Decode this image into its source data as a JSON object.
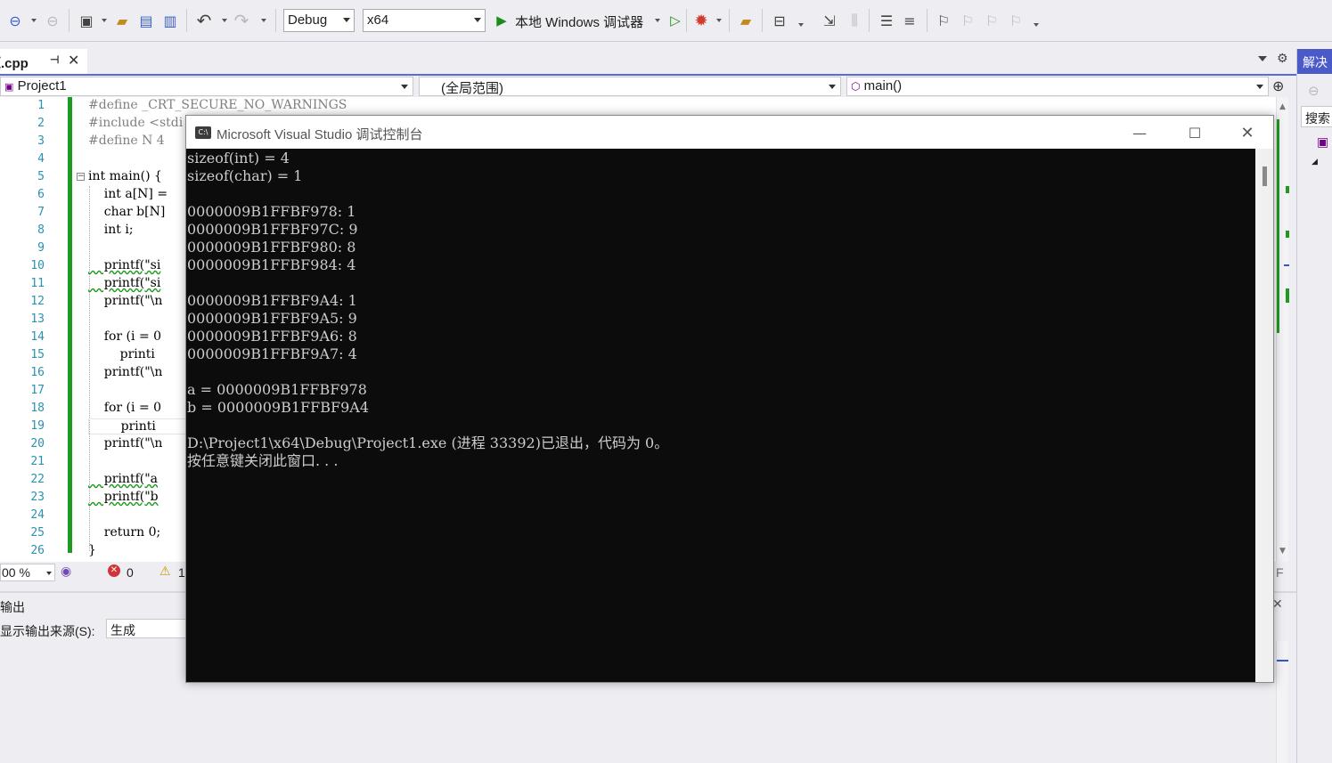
{
  "toolbar": {
    "config": "Debug",
    "platform": "x64",
    "run_label": "本地 Windows 调试器"
  },
  "tab": {
    "file_name": "源.cpp",
    "pin_icon": "pin-icon",
    "close_icon": "close-icon"
  },
  "navbar": {
    "project": "Project1",
    "scope": "(全局范围)",
    "member": "main()"
  },
  "editor": {
    "line_numbers": [
      "1",
      "2",
      "3",
      "4",
      "5",
      "6",
      "7",
      "8",
      "9",
      "10",
      "11",
      "12",
      "13",
      "14",
      "15",
      "16",
      "17",
      "18",
      "19",
      "20",
      "21",
      "22",
      "23",
      "24",
      "25",
      "26"
    ],
    "lines": [
      "#define _CRT_SECURE_NO_WARNINGS",
      "#include <stdi",
      "#define N 4",
      "",
      "int main() {",
      "    int a[N] =",
      "    char b[N]",
      "    int i;",
      "",
      "    printf(\"si",
      "    printf(\"si",
      "    printf(\"\\n",
      "",
      "    for (i = 0",
      "        printi",
      "    printf(\"\\n",
      "",
      "    for (i = 0",
      "        printi",
      "    printf(\"\\n",
      "",
      "    printf(\"a",
      "    printf(\"b",
      "",
      "    return 0;",
      "}"
    ]
  },
  "status": {
    "zoom": "00 %",
    "errors": "0",
    "warnings": "1",
    "right_letter": "F"
  },
  "output": {
    "title": "输出",
    "source_label": "显示输出来源(S):",
    "source_value": "生成"
  },
  "side_panel": {
    "title": "解决",
    "search": "搜索"
  },
  "console": {
    "title": "Microsoft Visual Studio 调试控制台",
    "icon_text": "C:\\",
    "lines": [
      "sizeof(int) = 4",
      "sizeof(char) = 1",
      "",
      "0000009B1FFBF978: 1",
      "0000009B1FFBF97C: 9",
      "0000009B1FFBF980: 8",
      "0000009B1FFBF984: 4",
      "",
      "0000009B1FFBF9A4: 1",
      "0000009B1FFBF9A5: 9",
      "0000009B1FFBF9A6: 8",
      "0000009B1FFBF9A7: 4",
      "",
      "a = 0000009B1FFBF978",
      "b = 0000009B1FFBF9A4",
      "",
      "D:\\Project1\\x64\\Debug\\Project1.exe (进程 33392)已退出，代码为 0。",
      "按任意键关闭此窗口. . ."
    ]
  }
}
